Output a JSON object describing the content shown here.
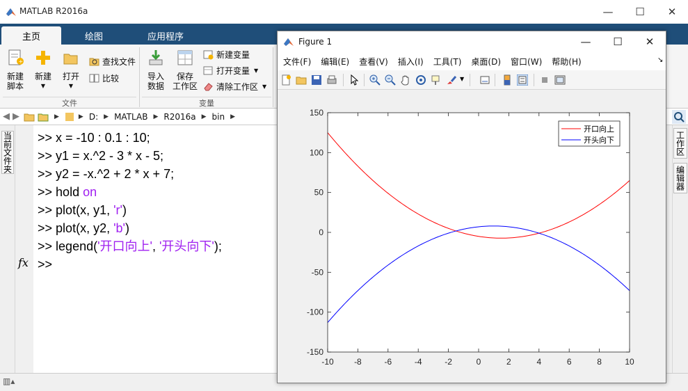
{
  "main_window": {
    "title": "MATLAB R2016a",
    "controls": {
      "minimize": "—",
      "maximize": "☐",
      "close": "✕"
    }
  },
  "tabs": [
    {
      "label": "主页"
    },
    {
      "label": "绘图"
    },
    {
      "label": "应用程序"
    }
  ],
  "ribbon": {
    "new_script": "新建\n脚本",
    "new": "新建",
    "open": "打开",
    "find_files": "查找文件",
    "compare": "比较",
    "import_data": "导入\n数据",
    "save_workspace": "保存\n工作区",
    "new_variable": "新建变量",
    "open_variable": "打开变量",
    "clear_workspace": "清除工作区",
    "group_file": "文件",
    "group_variable": "变量"
  },
  "address": {
    "path": [
      "D:",
      "MATLAB",
      "R2016a",
      "bin"
    ]
  },
  "left_panel": {
    "label": "当前文件夹"
  },
  "right_panel": {
    "workspace": "工作区",
    "editor": "编辑器"
  },
  "command_window": {
    "prompt": ">>",
    "fx": "fx",
    "lines": [
      {
        "code": "x = -10 : 0.1 : 10;"
      },
      {
        "code": "y1 = x.^2 - 3 * x - 5;"
      },
      {
        "code": "y2 = -x.^2 + 2 * x + 7;"
      },
      {
        "pre": "hold ",
        "kw": "on"
      },
      {
        "pre": "plot(x, y1, ",
        "str": "'r'",
        "post": ")"
      },
      {
        "pre": "plot(x, y2, ",
        "str": "'b'",
        "post": ")"
      },
      {
        "pre": "legend(",
        "str": "'开口向上'",
        "mid": ", ",
        "str2": "'开头向下'",
        "post": ");"
      }
    ]
  },
  "figure": {
    "title": "Figure 1",
    "menus": [
      "文件(F)",
      "编辑(E)",
      "查看(V)",
      "插入(I)",
      "工具(T)",
      "桌面(D)",
      "窗口(W)",
      "帮助(H)"
    ],
    "controls": {
      "minimize": "—",
      "maximize": "☐",
      "close": "✕"
    }
  },
  "colors": {
    "tabbar": "#1f4e79",
    "series1": "#ff0000",
    "series2": "#0000ff",
    "string": "#a020f0"
  },
  "chart_data": {
    "type": "line",
    "xlim": [
      -10,
      10
    ],
    "ylim": [
      -150,
      150
    ],
    "xticks": [
      -10,
      -8,
      -6,
      -4,
      -2,
      0,
      2,
      4,
      6,
      8,
      10
    ],
    "yticks": [
      -150,
      -100,
      -50,
      0,
      50,
      100,
      150
    ],
    "legend_position": "top-right",
    "grid": false,
    "series": [
      {
        "name": "开口向上",
        "color": "#ff0000",
        "formula": "y1 = x.^2 - 3 * x - 5",
        "coefficients": [
          1,
          -3,
          -5
        ]
      },
      {
        "name": "开头向下",
        "color": "#0000ff",
        "formula": "y2 = -x.^2 + 2 * x + 7",
        "coefficients": [
          -1,
          2,
          7
        ]
      }
    ],
    "x_domain": {
      "start": -10,
      "end": 10,
      "step": 0.1
    }
  }
}
